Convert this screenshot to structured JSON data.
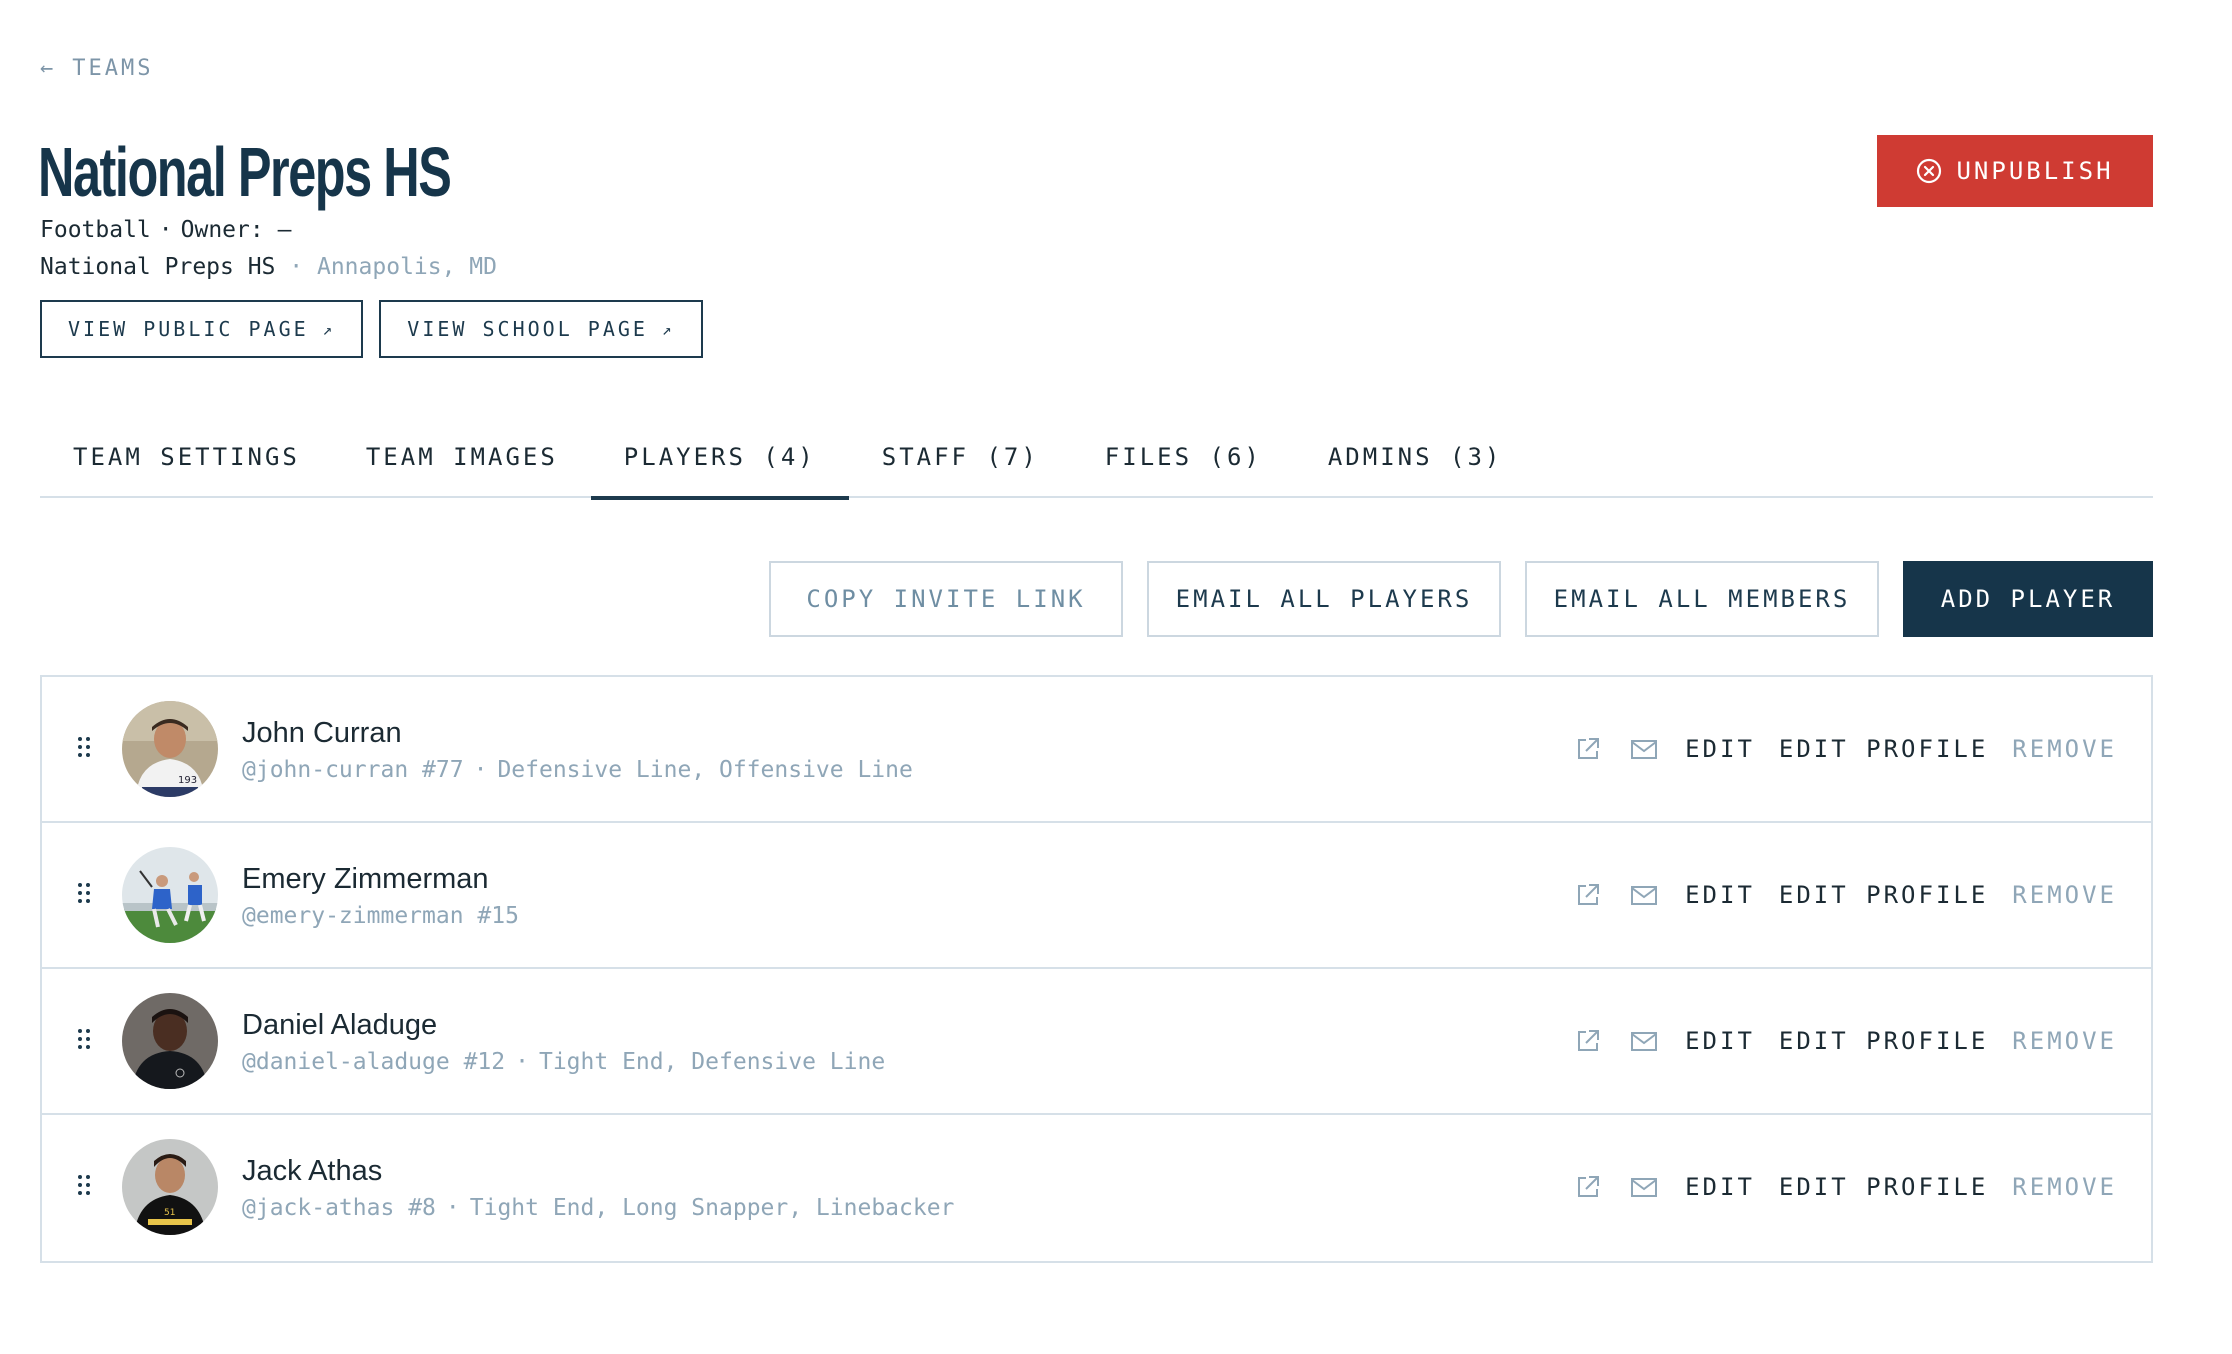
{
  "nav": {
    "back_arrow": "←",
    "back_label": "TEAMS"
  },
  "team": {
    "name": "National Preps HS",
    "sport": "Football",
    "owner_label": "Owner:",
    "owner_value": "—",
    "school": "National Preps HS",
    "location": "Annapolis, MD",
    "separator": "·"
  },
  "header_buttons": {
    "view_public": "VIEW PUBLIC PAGE",
    "view_school": "VIEW SCHOOL PAGE",
    "external_glyph": "↗",
    "unpublish": "UNPUBLISH"
  },
  "tabs": [
    {
      "label": "TEAM SETTINGS"
    },
    {
      "label": "TEAM IMAGES"
    },
    {
      "label": "PLAYERS (4)",
      "active": true
    },
    {
      "label": "STAFF (7)"
    },
    {
      "label": "FILES (6)"
    },
    {
      "label": "ADMINS (3)"
    }
  ],
  "actions": {
    "copy_invite": "COPY INVITE LINK",
    "email_players": "EMAIL ALL PLAYERS",
    "email_members": "EMAIL ALL MEMBERS",
    "add_player": "ADD PLAYER"
  },
  "players": [
    {
      "name": "John Curran",
      "handle": "@john-curran",
      "number": "#77",
      "positions": "Defensive Line, Offensive Line",
      "avatar": "player-photo"
    },
    {
      "name": "Emery Zimmerman",
      "handle": "@emery-zimmerman",
      "number": "#15",
      "positions": "",
      "avatar": "action-photo"
    },
    {
      "name": "Daniel Aladuge",
      "handle": "@daniel-aladuge",
      "number": "#12",
      "positions": "Tight End, Defensive Line",
      "avatar": "player-photo"
    },
    {
      "name": "Jack Athas",
      "handle": "@jack-athas",
      "number": "#8",
      "positions": "Tight End, Long Snapper, Linebacker",
      "avatar": "player-photo"
    }
  ],
  "row_actions": {
    "edit": "EDIT",
    "edit_profile": "EDIT PROFILE",
    "remove": "REMOVE",
    "open_icon": "external-link-icon",
    "mail_icon": "mail-icon"
  },
  "colors": {
    "primary": "#16354a",
    "danger": "#cf3b33",
    "muted": "#8fa6b7",
    "border": "#d6e0e8"
  }
}
